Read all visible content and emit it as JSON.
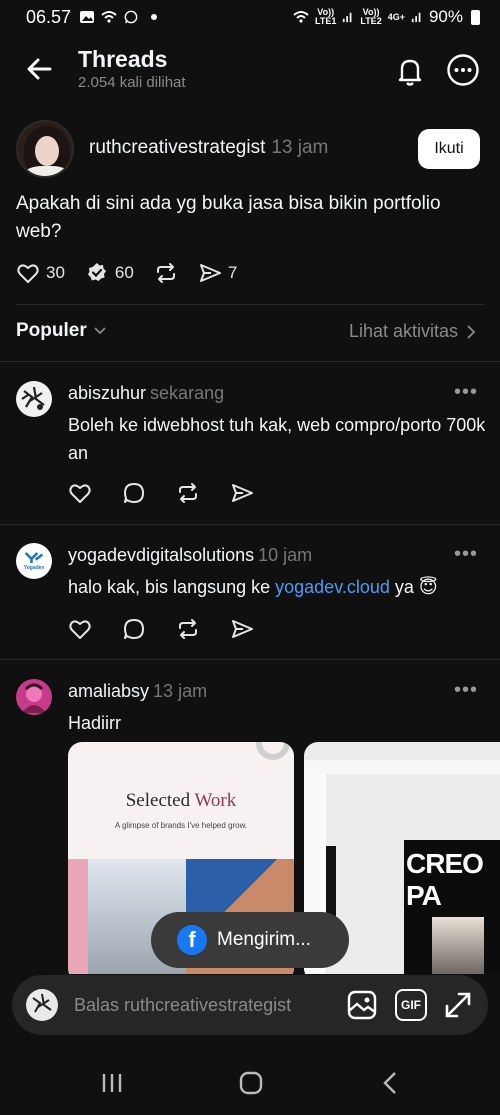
{
  "status_bar": {
    "time": "06.57",
    "sim1_top": "Vo))",
    "sim1_bottom": "LTE1",
    "sim2_top": "Vo))",
    "sim2_bottom": "LTE2",
    "net": "4G+",
    "battery": "90%"
  },
  "header": {
    "title": "Threads",
    "views": "2.054 kali dilihat"
  },
  "post": {
    "author": "ruthcreativestrategist",
    "time": "13 jam",
    "follow_label": "Ikuti",
    "text": "Apakah di sini ada yg buka jasa bisa bikin portfolio web?",
    "likes": "30",
    "reposts": "60",
    "shares": "7"
  },
  "sort": {
    "label": "Populer",
    "activity_link": "Lihat aktivitas"
  },
  "replies": [
    {
      "author": "abiszuhur",
      "time": "sekarang",
      "text": "Boleh ke idwebhost tuh kak, web compro/porto 700k an"
    },
    {
      "author": "yogadevdigitalsolutions",
      "time": "10 jam",
      "text_before": "halo kak, bis langsung ke ",
      "link": "yogadev.cloud",
      "text_after": " ya 😇",
      "avatar_text": "Yogadev"
    },
    {
      "author": "amaliabsy",
      "time": "13 jam",
      "text": "Hadiirr"
    }
  ],
  "gallery": {
    "card1_title_a": "Selected",
    "card1_title_b": "Work",
    "card1_subtitle": "A glimpse of brands I've helped grow.",
    "card2_heading": "CREO PA"
  },
  "toast": {
    "label": "Mengirim..."
  },
  "reply_bar": {
    "placeholder": "Balas ruthcreativestrategist",
    "gif_label": "GIF"
  },
  "colors": {
    "background": "#101010",
    "link": "#4a9bf7",
    "facebook": "#1877f2"
  }
}
